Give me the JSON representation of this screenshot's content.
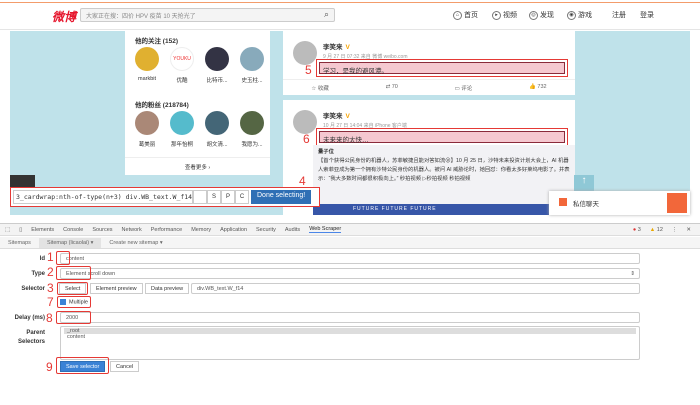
{
  "weibo": {
    "logo": "微博",
    "search_placeholder": "大家正在搜：四价 HPV 疫苗 10 天抢光了",
    "nav": [
      "首页",
      "视频",
      "发现",
      "游戏",
      "注册",
      "登录"
    ]
  },
  "left_card": {
    "following_title": "他的关注 (152)",
    "following": [
      "markbit",
      "优酷",
      "比特币...",
      "史玉柱..."
    ],
    "fans_title": "他的粉丝 (218784)",
    "fans": [
      "葛美丽",
      "那年怡桐",
      "胡文清...",
      "我愿为..."
    ],
    "more": "查看更多 ›"
  },
  "posts": [
    {
      "author": "李笑来",
      "time": "9 月 27 日 07:32 来自 微博 weibo.com",
      "text": "学习，是我的避风港。",
      "actions": [
        "收藏",
        "70",
        "评论",
        "732"
      ],
      "marker": "5"
    },
    {
      "author": "李笑来",
      "time": "10 月 27 日 14:04 来自 iPhone 客户端",
      "text": "未来来的太快…",
      "marker": "6",
      "repost_author": "量子位",
      "repost_text": "【首个获得公民身份的机器人，苏菲敏捷且能对答如流😮】10 月 25 日，沙特未来投资计划大会上，AI 机器人索菲亚成为第一个拥有沙特公民身份的机器人。被问 AI 威胁论时，她回怼：你看太多好莱坞电影了。并表示：“我大多数时间都很积极向上。” 秒拍视频 ▷秒拍视频 秒拍视频",
      "banner": "FUTURE      FUTURE      FUTURE"
    }
  ],
  "selector_bar": {
    "value": "3_cardwrap:nth-of-type(n+3) div.WB_text.W_f14",
    "buttons": [
      "S",
      "P",
      "C"
    ],
    "done": "Done selecting!",
    "marker": "4"
  },
  "chat": {
    "label": "私信聊天"
  },
  "devtools": {
    "tabs": [
      "Elements",
      "Console",
      "Sources",
      "Network",
      "Performance",
      "Memory",
      "Application",
      "Security",
      "Audits",
      "Web Scraper"
    ],
    "errors": "3",
    "warnings": "12"
  },
  "scraper": {
    "subtabs": [
      "Sitemaps",
      "Sitemap (licaolai) ▾",
      "Create new sitemap ▾"
    ],
    "id_label": "Id",
    "id_value": "content",
    "type_label": "Type",
    "type_value": "Element scroll down",
    "selector_label": "Selector",
    "select_btn": "Select",
    "element_preview": "Element preview",
    "data_preview": "Data preview",
    "selector_value": "div.WB_text.W_f14",
    "multiple_label": "Multiple",
    "multiple_checked": true,
    "delay_label": "Delay (ms)",
    "delay_value": "2000",
    "parent_label": "Parent Selectors",
    "parents": [
      "_root",
      "content"
    ],
    "save": "Save selector",
    "cancel": "Cancel",
    "markers": [
      "1",
      "2",
      "3",
      "7",
      "8",
      "9"
    ]
  }
}
